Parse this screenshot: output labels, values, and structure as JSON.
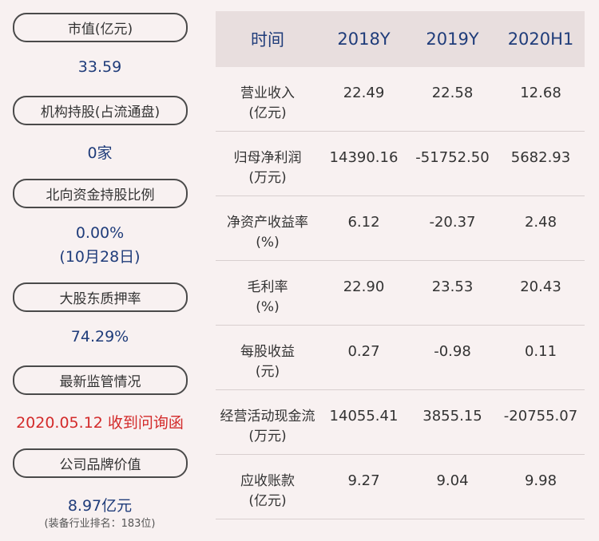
{
  "left": {
    "items": [
      {
        "label": "市值(亿元)",
        "value": "33.59"
      },
      {
        "label": "机构持股(占流通盘)",
        "value": "0家"
      },
      {
        "label": "北向资金持股比例",
        "value": "0.00%",
        "value2": "(10月28日)"
      },
      {
        "label": "大股东质押率",
        "value": "74.29%"
      },
      {
        "label": "最新监管情况",
        "value": "2020.05.12 收到问询函"
      },
      {
        "label": "公司品牌价值",
        "value": "8.97亿元",
        "note": "(装备行业排名：183位)"
      }
    ]
  },
  "table": {
    "headers": [
      "时间",
      "2018Y",
      "2019Y",
      "2020H1"
    ],
    "rows": [
      {
        "label": "营业收入",
        "unit": "(亿元)",
        "values": [
          "22.49",
          "22.58",
          "12.68"
        ]
      },
      {
        "label": "归母净利润",
        "unit": "(万元)",
        "values": [
          "14390.16",
          "-51752.50",
          "5682.93"
        ]
      },
      {
        "label": "净资产收益率",
        "unit": "(%)",
        "values": [
          "6.12",
          "-20.37",
          "2.48"
        ]
      },
      {
        "label": "毛利率",
        "unit": "(%)",
        "values": [
          "22.90",
          "23.53",
          "20.43"
        ]
      },
      {
        "label": "每股收益",
        "unit": "(元)",
        "values": [
          "0.27",
          "-0.98",
          "0.11"
        ]
      },
      {
        "label": "经营活动现金流",
        "unit": "(万元)",
        "values": [
          "14055.41",
          "3855.15",
          "-20755.07"
        ]
      },
      {
        "label": "应收账款",
        "unit": "(亿元)",
        "values": [
          "9.27",
          "9.04",
          "9.98"
        ]
      }
    ]
  },
  "colors": {
    "background": "#f8f1f1",
    "header_bg": "#e8dede",
    "value_blue": "#1f3c7a",
    "alert_red": "#d32a2a"
  }
}
